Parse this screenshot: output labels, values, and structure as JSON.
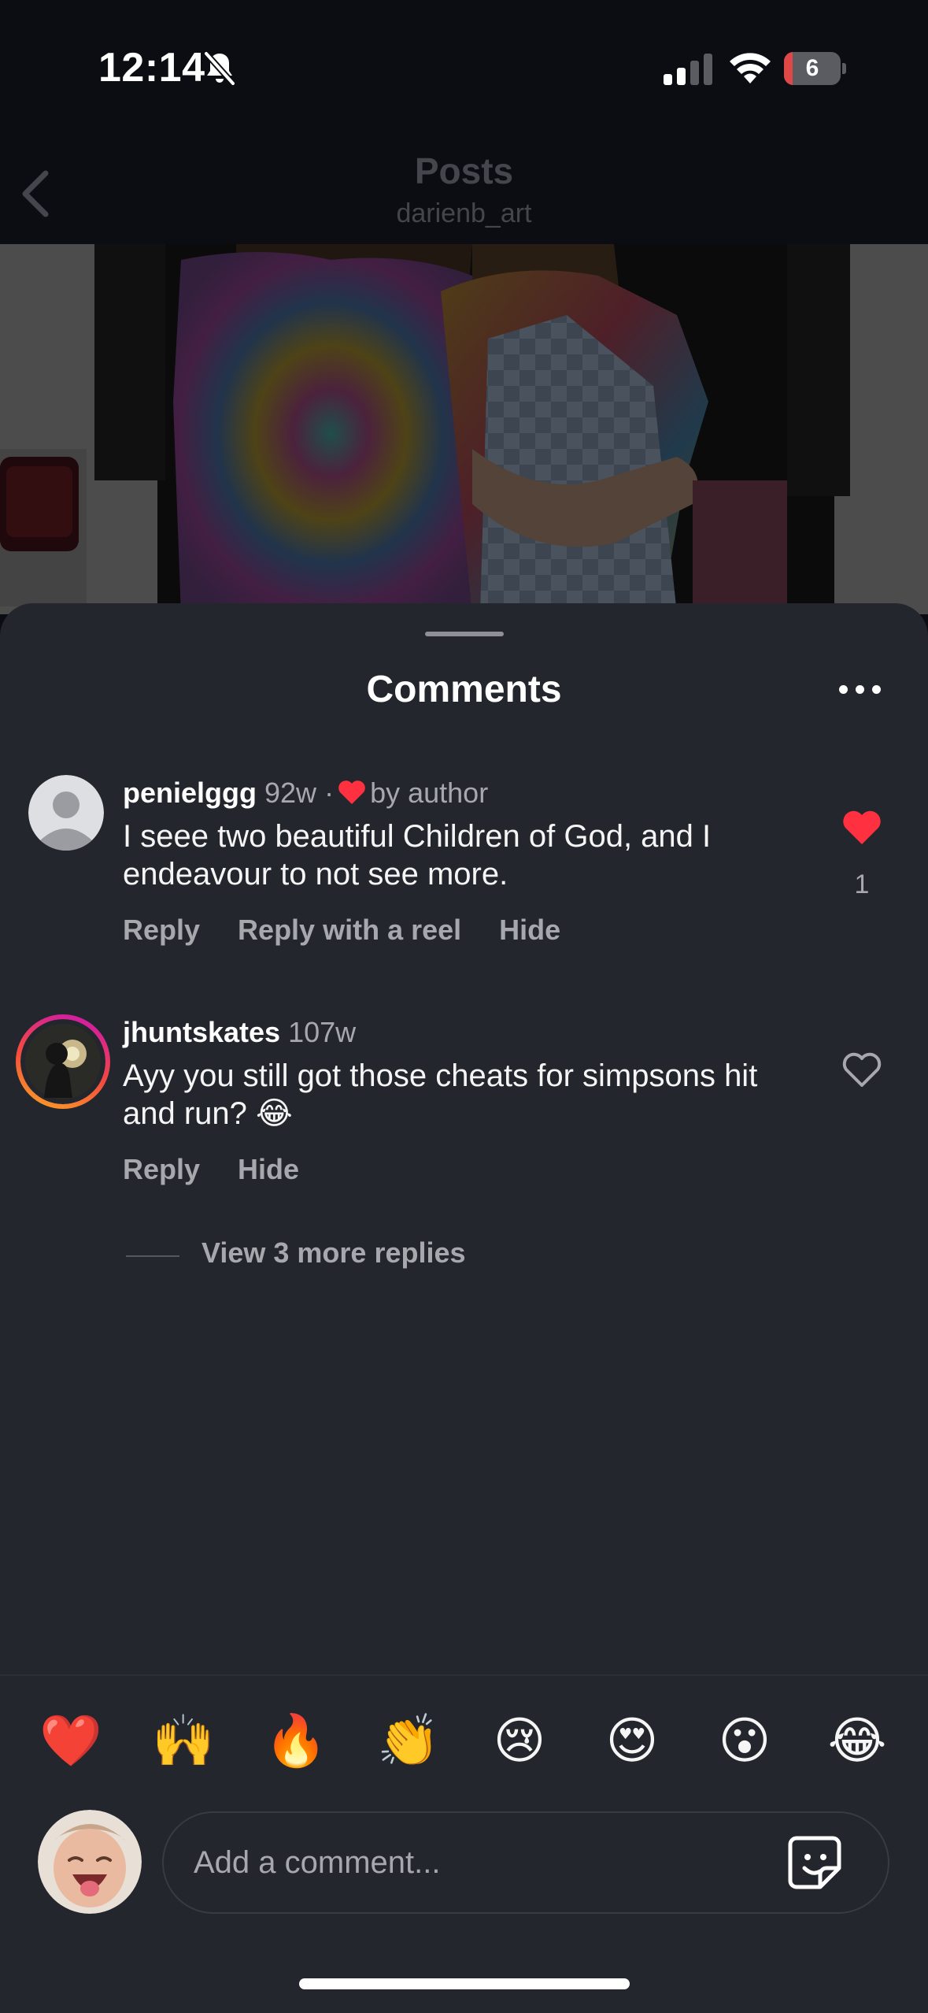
{
  "status_bar": {
    "time": "12:14",
    "battery_level": "6",
    "battery_fraction": 0.06,
    "icons": [
      "bell-slash-icon",
      "cellular-signal-icon",
      "wifi-icon",
      "battery-icon"
    ]
  },
  "header": {
    "title": "Posts",
    "username": "darienb_art",
    "back_icon": "chevron-left-icon"
  },
  "sheet": {
    "title": "Comments",
    "more_icon": "ellipsis-icon"
  },
  "comments": [
    {
      "username": "penielggg",
      "age": "92w",
      "separator": "·",
      "liked_by": "by author",
      "text": "I seee two beautiful Children of God, and I endeavour to not see more.",
      "actions": [
        "Reply",
        "Reply with a reel",
        "Hide"
      ],
      "likes": "1",
      "liked": true
    },
    {
      "username": "jhuntskates",
      "age": "107w",
      "text": "Ayy you still got those cheats for simpsons hit and run? 😂",
      "actions": [
        "Reply",
        "Hide"
      ],
      "liked": false
    }
  ],
  "view_replies": "View 3 more replies",
  "emojis": [
    "❤️",
    "🙌",
    "🔥",
    "👏",
    "😢",
    "😍",
    "😮",
    "😂"
  ],
  "composer": {
    "placeholder": "Add a comment...",
    "sticker_icon": "sticker-icon"
  },
  "colors": {
    "background": "#0b0d12",
    "sheet": "#23262c",
    "like_red": "#ff3040",
    "muted_text": "#a6a8ad",
    "story_ring_start": "#c913b9",
    "story_ring_end": "#f9a825"
  }
}
